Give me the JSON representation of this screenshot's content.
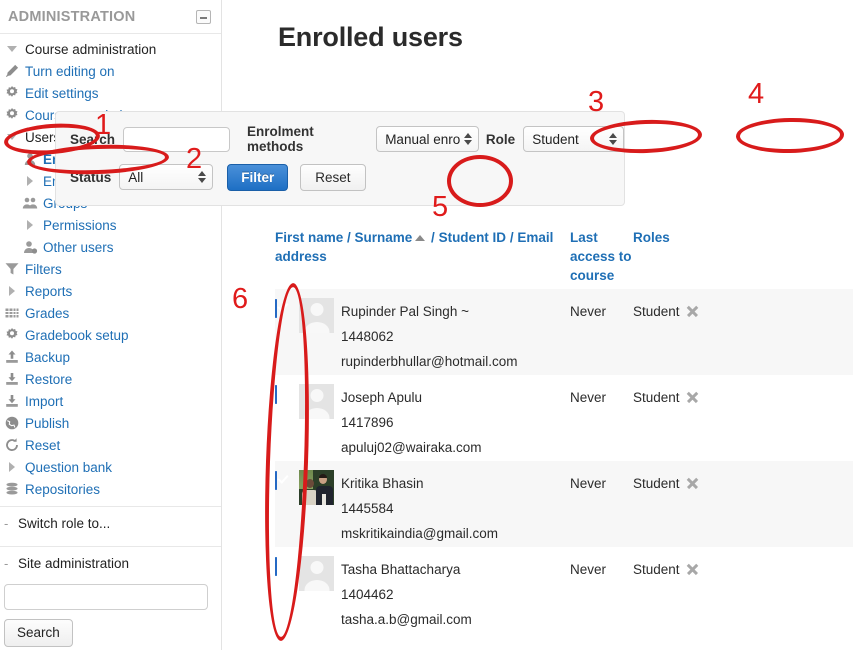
{
  "sidebar": {
    "title": "ADMINISTRATION",
    "collapse_icon": "minus-box-icon",
    "nav": [
      {
        "label": "Course administration",
        "icon": "triangle-down-icon",
        "level": 1,
        "style": "plain"
      },
      {
        "label": "Turn editing on",
        "icon": "pencil-icon",
        "level": 1,
        "style": "link"
      },
      {
        "label": "Edit settings",
        "icon": "gear-icon",
        "level": 1,
        "style": "link"
      },
      {
        "label": "Course completion",
        "icon": "gear-icon",
        "level": 1,
        "style": "link"
      },
      {
        "label": "Users",
        "icon": "triangle-down-icon",
        "level": 1,
        "style": "plain"
      },
      {
        "label": "Enrolled users",
        "icon": "user-icon",
        "level": 2,
        "style": "bold"
      },
      {
        "label": "Enrolment methods",
        "icon": "triangle-right-icon",
        "level": 2,
        "style": "link"
      },
      {
        "label": "Groups",
        "icon": "group-icon",
        "level": 2,
        "style": "link"
      },
      {
        "label": "Permissions",
        "icon": "triangle-right-icon",
        "level": 2,
        "style": "link"
      },
      {
        "label": "Other users",
        "icon": "user-add-icon",
        "level": 2,
        "style": "link"
      },
      {
        "label": "Filters",
        "icon": "funnel-icon",
        "level": 1,
        "style": "link"
      },
      {
        "label": "Reports",
        "icon": "triangle-right-icon",
        "level": 1,
        "style": "link"
      },
      {
        "label": "Grades",
        "icon": "grid-icon",
        "level": 1,
        "style": "link"
      },
      {
        "label": "Gradebook setup",
        "icon": "gear-icon",
        "level": 1,
        "style": "link"
      },
      {
        "label": "Backup",
        "icon": "upload-icon",
        "level": 1,
        "style": "link"
      },
      {
        "label": "Restore",
        "icon": "download-icon",
        "level": 1,
        "style": "link"
      },
      {
        "label": "Import",
        "icon": "download-icon",
        "level": 1,
        "style": "link"
      },
      {
        "label": "Publish",
        "icon": "globe-icon",
        "level": 1,
        "style": "link"
      },
      {
        "label": "Reset",
        "icon": "refresh-icon",
        "level": 1,
        "style": "link"
      },
      {
        "label": "Question bank",
        "icon": "triangle-right-icon",
        "level": 1,
        "style": "link"
      },
      {
        "label": "Repositories",
        "icon": "database-icon",
        "level": 1,
        "style": "link"
      }
    ],
    "switch_role": "Switch role to...",
    "site_administration": "Site administration",
    "search_value": "",
    "search_placeholder": "",
    "search_button": "Search"
  },
  "main": {
    "page_title": "Enrolled users",
    "filter": {
      "search_label": "Search",
      "search_value": "",
      "search_placeholder": "",
      "enrolment_label": "Enrolment methods",
      "enrolment_value": "Manual enro",
      "role_label": "Role",
      "role_value": "Student",
      "status_label": "Status",
      "status_value": "All",
      "filter_button": "Filter",
      "reset_button": "Reset"
    },
    "table": {
      "headers": {
        "name": "First name / Surname",
        "name_sep1": " / ",
        "name_id": "Student ID",
        "name_sep2": " / ",
        "name_email": "Email address",
        "last_access": "Last access to course",
        "roles": "Roles"
      },
      "sort_indicator": "ascending-sort-arrow",
      "rows": [
        {
          "checked": true,
          "avatar": "placeholder-avatar",
          "name": "Rupinder Pal Singh ~",
          "student_id": "1448062",
          "email": "rupinderbhullar@hotmail.com",
          "last_access": "Never",
          "role": "Student"
        },
        {
          "checked": true,
          "avatar": "placeholder-avatar",
          "name": "Joseph Apulu",
          "student_id": "1417896",
          "email": "apuluj02@wairaka.com",
          "last_access": "Never",
          "role": "Student"
        },
        {
          "checked": true,
          "avatar": "photo-avatar",
          "name": "Kritika Bhasin",
          "student_id": "1445584",
          "email": "mskritikaindia@gmail.com",
          "last_access": "Never",
          "role": "Student"
        },
        {
          "checked": true,
          "avatar": "placeholder-avatar",
          "name": "Tasha Bhattacharya",
          "student_id": "1404462",
          "email": "tasha.a.b@gmail.com",
          "last_access": "Never",
          "role": "Student"
        }
      ]
    }
  },
  "annotations": {
    "color": "#d81b1b",
    "numbers": [
      {
        "label": "1",
        "target": "users-nav-item"
      },
      {
        "label": "2",
        "target": "enrolled-users-nav-item"
      },
      {
        "label": "3",
        "target": "enrolment-methods-select"
      },
      {
        "label": "4",
        "target": "role-select"
      },
      {
        "label": "5",
        "target": "filter-button"
      },
      {
        "label": "6",
        "target": "row-checkbox-column"
      }
    ]
  }
}
